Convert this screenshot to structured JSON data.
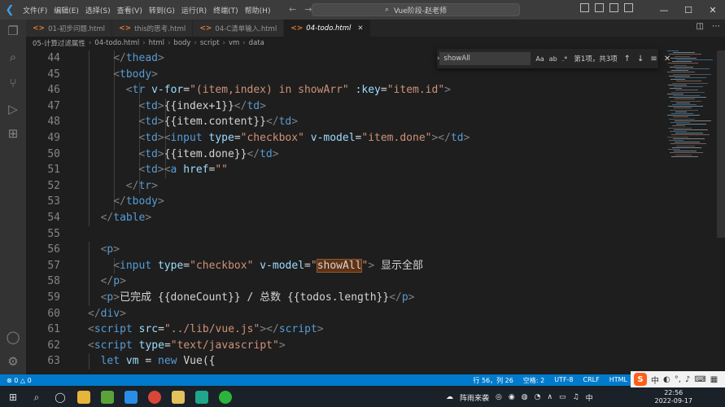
{
  "titlebar": {
    "menus": [
      "文件(F)",
      "编辑(E)",
      "选择(S)",
      "查看(V)",
      "转到(G)",
      "运行(R)",
      "终端(T)",
      "帮助(H)"
    ],
    "title": "Vue阶段-赵老师",
    "back": "←",
    "forward": "→",
    "minimize": "—",
    "maximize": "☐",
    "close": "✕"
  },
  "tabs": [
    {
      "label": "01-初步问题.html",
      "active": false
    },
    {
      "label": "this的思考.html",
      "active": false
    },
    {
      "label": "04-C清单输入.html",
      "active": false
    },
    {
      "label": "04-todo.html",
      "active": true
    }
  ],
  "breadcrumb": [
    "05-计算过滤属性",
    "04-todo.html",
    "html",
    "body",
    "script",
    "vm",
    "data"
  ],
  "find": {
    "value": "showAll",
    "options": [
      "Aa",
      "ab",
      ".*"
    ],
    "count": "第1项，共3项"
  },
  "code_lines": [
    {
      "n": "44",
      "indent": 2,
      "tokens": [
        [
          "br",
          "</"
        ],
        [
          "tag",
          "thead"
        ],
        [
          "br",
          ">"
        ]
      ]
    },
    {
      "n": "45",
      "indent": 2,
      "tokens": [
        [
          "br",
          "<"
        ],
        [
          "tag",
          "tbody"
        ],
        [
          "br",
          ">"
        ]
      ]
    },
    {
      "n": "46",
      "indent": 3,
      "tokens": [
        [
          "br",
          "<"
        ],
        [
          "tag",
          "tr"
        ],
        [
          "txt",
          " "
        ],
        [
          "attr",
          "v-for"
        ],
        [
          "txt",
          "="
        ],
        [
          "str",
          "\"(item,index) in showArr\""
        ],
        [
          "txt",
          " "
        ],
        [
          "attr",
          ":key"
        ],
        [
          "txt",
          "="
        ],
        [
          "str",
          "\"item.id\""
        ],
        [
          "br",
          ">"
        ]
      ]
    },
    {
      "n": "47",
      "indent": 4,
      "tokens": [
        [
          "br",
          "<"
        ],
        [
          "tag",
          "td"
        ],
        [
          "br",
          ">"
        ],
        [
          "txt",
          "{{index+1}}"
        ],
        [
          "br",
          "</"
        ],
        [
          "tag",
          "td"
        ],
        [
          "br",
          ">"
        ]
      ]
    },
    {
      "n": "48",
      "indent": 4,
      "tokens": [
        [
          "br",
          "<"
        ],
        [
          "tag",
          "td"
        ],
        [
          "br",
          ">"
        ],
        [
          "txt",
          "{{item.content}}"
        ],
        [
          "br",
          "</"
        ],
        [
          "tag",
          "td"
        ],
        [
          "br",
          ">"
        ]
      ]
    },
    {
      "n": "49",
      "indent": 4,
      "tokens": [
        [
          "br",
          "<"
        ],
        [
          "tag",
          "td"
        ],
        [
          "br",
          ">"
        ],
        [
          "br",
          "<"
        ],
        [
          "tag",
          "input"
        ],
        [
          "txt",
          " "
        ],
        [
          "attr",
          "type"
        ],
        [
          "txt",
          "="
        ],
        [
          "str",
          "\"checkbox\""
        ],
        [
          "txt",
          " "
        ],
        [
          "attr",
          "v-model"
        ],
        [
          "txt",
          "="
        ],
        [
          "str",
          "\"item.done\""
        ],
        [
          "br",
          ">"
        ],
        [
          "br",
          "</"
        ],
        [
          "tag",
          "td"
        ],
        [
          "br",
          ">"
        ]
      ]
    },
    {
      "n": "50",
      "indent": 4,
      "tokens": [
        [
          "br",
          "<"
        ],
        [
          "tag",
          "td"
        ],
        [
          "br",
          ">"
        ],
        [
          "txt",
          "{{item.done}}"
        ],
        [
          "br",
          "</"
        ],
        [
          "tag",
          "td"
        ],
        [
          "br",
          ">"
        ]
      ]
    },
    {
      "n": "51",
      "indent": 4,
      "tokens": [
        [
          "br",
          "<"
        ],
        [
          "tag",
          "td"
        ],
        [
          "br",
          ">"
        ],
        [
          "br",
          "<"
        ],
        [
          "tag",
          "a"
        ],
        [
          "txt",
          " "
        ],
        [
          "attr",
          "href"
        ],
        [
          "txt",
          "="
        ],
        [
          "str",
          "\"\""
        ]
      ]
    },
    {
      "n": "52",
      "indent": 3,
      "tokens": [
        [
          "br",
          "</"
        ],
        [
          "tag",
          "tr"
        ],
        [
          "br",
          ">"
        ]
      ]
    },
    {
      "n": "53",
      "indent": 2,
      "tokens": [
        [
          "br",
          "</"
        ],
        [
          "tag",
          "tbody"
        ],
        [
          "br",
          ">"
        ]
      ]
    },
    {
      "n": "54",
      "indent": 1,
      "tokens": [
        [
          "br",
          "</"
        ],
        [
          "tag",
          "table"
        ],
        [
          "br",
          ">"
        ]
      ]
    },
    {
      "n": "55",
      "indent": 0,
      "tokens": []
    },
    {
      "n": "56",
      "indent": 1,
      "tokens": [
        [
          "br",
          "<"
        ],
        [
          "tag",
          "p"
        ],
        [
          "br",
          ">"
        ]
      ]
    },
    {
      "n": "57",
      "indent": 2,
      "tokens": [
        [
          "br",
          "<"
        ],
        [
          "tag",
          "input"
        ],
        [
          "txt",
          " "
        ],
        [
          "attr",
          "type"
        ],
        [
          "txt",
          "="
        ],
        [
          "str",
          "\"checkbox\""
        ],
        [
          "txt",
          " "
        ],
        [
          "attr",
          "v-model"
        ],
        [
          "txt",
          "="
        ],
        [
          "str",
          "\""
        ],
        [
          "hl",
          "showAll"
        ],
        [
          "str",
          "\""
        ],
        [
          "br",
          ">"
        ],
        [
          "txt",
          " 显示全部"
        ]
      ]
    },
    {
      "n": "58",
      "indent": 1,
      "tokens": [
        [
          "br",
          "</"
        ],
        [
          "tag",
          "p"
        ],
        [
          "br",
          ">"
        ]
      ]
    },
    {
      "n": "59",
      "indent": 1,
      "tokens": [
        [
          "br",
          "<"
        ],
        [
          "tag",
          "p"
        ],
        [
          "br",
          ">"
        ],
        [
          "txt",
          "已完成 {{doneCount}} / 总数 {{todos.length}}"
        ],
        [
          "br",
          "</"
        ],
        [
          "tag",
          "p"
        ],
        [
          "br",
          ">"
        ]
      ]
    },
    {
      "n": "60",
      "indent": 0,
      "tokens": [
        [
          "br",
          "</"
        ],
        [
          "tag",
          "div"
        ],
        [
          "br",
          ">"
        ]
      ]
    },
    {
      "n": "61",
      "indent": 0,
      "tokens": [
        [
          "br",
          "<"
        ],
        [
          "tag",
          "script"
        ],
        [
          "txt",
          " "
        ],
        [
          "attr",
          "src"
        ],
        [
          "txt",
          "="
        ],
        [
          "str",
          "\"../lib/vue.js\""
        ],
        [
          "br",
          "></"
        ],
        [
          "tag",
          "script"
        ],
        [
          "br",
          ">"
        ]
      ]
    },
    {
      "n": "62",
      "indent": 0,
      "tokens": [
        [
          "br",
          "<"
        ],
        [
          "tag",
          "script"
        ],
        [
          "txt",
          " "
        ],
        [
          "attr",
          "type"
        ],
        [
          "txt",
          "="
        ],
        [
          "str",
          "\"text/javascript\""
        ],
        [
          "br",
          ">"
        ]
      ]
    },
    {
      "n": "63",
      "indent": 1,
      "tokens": [
        [
          "tag",
          "let"
        ],
        [
          "txt",
          " "
        ],
        [
          "attr",
          "vm"
        ],
        [
          "txt",
          " = "
        ],
        [
          "tag",
          "new"
        ],
        [
          "txt",
          " Vue({"
        ]
      ]
    }
  ],
  "status": {
    "problems": "⊗ 0 △ 0",
    "position": "行 56，列 26",
    "spaces": "空格: 2",
    "encoding": "UTF-8",
    "eol": "CRLF",
    "language": "HTML"
  },
  "ime": {
    "logo": "S",
    "mode": "中"
  },
  "taskbar": {
    "weather": "阵雨来袭",
    "time": "22:56",
    "date": "2022-09-17"
  },
  "colors": {
    "editor_bg": "#1e1e1e",
    "status_bg": "#007acc",
    "tag": "#569cd6",
    "attr": "#9cdcfe",
    "string": "#ce9178"
  }
}
